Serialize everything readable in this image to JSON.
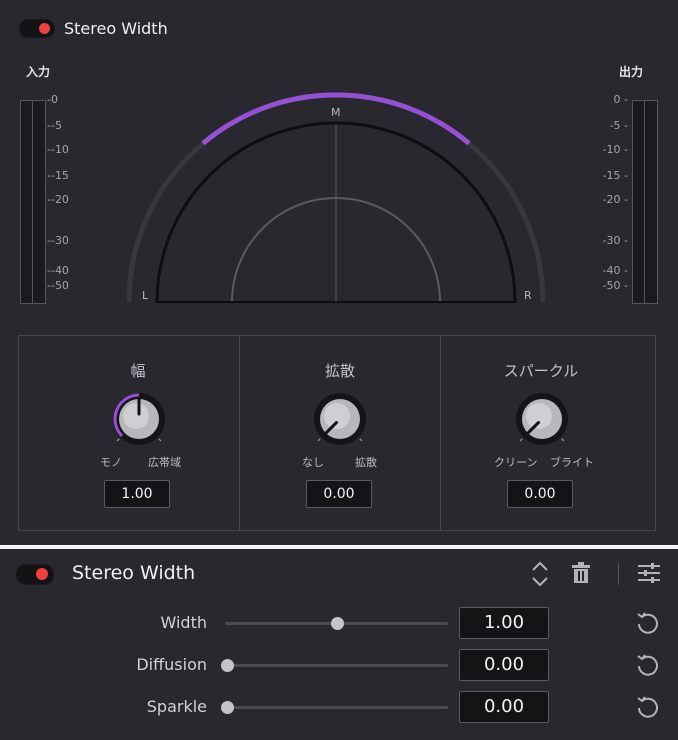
{
  "colors": {
    "background": "#28282e",
    "accent_purple": "#9550d6",
    "toggle_on": "#ef4040",
    "meter_bg": "#1b1b1f"
  },
  "top_panel": {
    "toggle_state": "on",
    "title": "Stereo Width",
    "input_label": "入力",
    "output_label": "出力",
    "meter_ticks": [
      "0",
      "-5",
      "-10",
      "-15",
      "-20",
      "-30",
      "-40",
      "-50"
    ],
    "scope_labels": {
      "left": "L",
      "mid": "M",
      "right": "R"
    },
    "width_arc_value": 1.0,
    "knobs": [
      {
        "title": "幅",
        "min_label": "モノ",
        "max_label": "広帯域",
        "value": "1.00",
        "level": 0.5
      },
      {
        "title": "拡散",
        "min_label": "なし",
        "max_label": "拡散",
        "value": "0.00",
        "level": 0.0
      },
      {
        "title": "スパークル",
        "min_label": "クリーン",
        "max_label": "ブライト",
        "value": "0.00",
        "level": 0.0
      }
    ]
  },
  "bottom_panel": {
    "toggle_state": "on",
    "title": "Stereo Width",
    "icons": [
      "expand-collapse-icon",
      "trash-icon",
      "sliders-icon"
    ],
    "params": [
      {
        "label": "Width",
        "value": "1.00",
        "level": 0.5
      },
      {
        "label": "Diffusion",
        "value": "0.00",
        "level": 0.0
      },
      {
        "label": "Sparkle",
        "value": "0.00",
        "level": 0.0
      }
    ]
  }
}
